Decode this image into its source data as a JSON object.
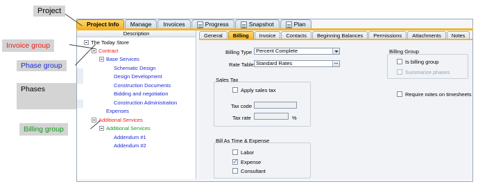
{
  "top_tabs": [
    {
      "label": "Project Info",
      "icon": "",
      "active": true
    },
    {
      "label": "Manage",
      "icon": ""
    },
    {
      "label": "Invoices",
      "icon": ""
    },
    {
      "label": "Progress",
      "icon": "document-icon"
    },
    {
      "label": "Snapshot",
      "icon": "document-icon"
    },
    {
      "label": "Plan",
      "icon": "document-icon"
    }
  ],
  "tree": {
    "header": "Description",
    "rows": [
      {
        "label": "The Today Store",
        "toggle": true,
        "color": "black"
      },
      {
        "label": "Contract",
        "toggle": true,
        "color": "red"
      },
      {
        "label": "Base Services",
        "toggle": true,
        "color": "blue"
      },
      {
        "label": "Schematic Design",
        "toggle": false,
        "color": "blue"
      },
      {
        "label": "Design Development",
        "toggle": false,
        "color": "blue"
      },
      {
        "label": "Construction Documents",
        "toggle": false,
        "color": "blue"
      },
      {
        "label": "Bidding and negotiation",
        "toggle": false,
        "color": "blue"
      },
      {
        "label": "Construction Administration",
        "toggle": false,
        "color": "blue"
      },
      {
        "label": "Expenses",
        "toggle": false,
        "color": "blue"
      },
      {
        "label": "Additional Services",
        "toggle": true,
        "color": "red"
      },
      {
        "label": "Additional Services",
        "toggle": true,
        "color": "green"
      },
      {
        "label": "Addendum #1",
        "toggle": false,
        "color": "blue"
      },
      {
        "label": "Addendum #2",
        "toggle": false,
        "color": "blue"
      }
    ]
  },
  "sub_tabs": [
    {
      "label": "General"
    },
    {
      "label": "Billing",
      "active": true
    },
    {
      "label": "Invoice"
    },
    {
      "label": "Contacts"
    },
    {
      "label": "Beginning Balances"
    },
    {
      "label": "Permissions"
    },
    {
      "label": "Attachments"
    },
    {
      "label": "Notes"
    }
  ],
  "billing": {
    "billing_type_label": "Billing Type",
    "billing_type_value": "Percent Complete",
    "rate_table_label": "Rate Table",
    "rate_table_value": "Standard Rates",
    "sales_tax": {
      "title": "Sales Tax",
      "apply_label": "Apply sales tax",
      "apply_checked": false,
      "tax_code_label": "Tax code",
      "tax_code_value": "",
      "tax_rate_label": "Tax rate",
      "tax_rate_value": "",
      "percent_sign": "%"
    },
    "time_expense": {
      "title": "Bill As Time & Expense",
      "items": [
        {
          "label": "Labor",
          "checked": false
        },
        {
          "label": "Expense",
          "checked": true
        },
        {
          "label": "Consultant",
          "checked": false
        }
      ]
    },
    "billing_group": {
      "title": "Billing Group",
      "is_billing_group_label": "Is billing group",
      "is_billing_group_checked": false,
      "summarize_label": "Summarize phases",
      "summarize_checked": false
    },
    "require_notes_label": "Require notes on timesheets",
    "require_notes_checked": false
  },
  "callouts": {
    "project": "Project",
    "invoice_group": "Invoice group",
    "phase_group": "Phase group",
    "phases": "Phases",
    "billing_group": "Billing group"
  },
  "colors": {
    "accent": "#f5b323",
    "invoice_group_text": "#e8201a",
    "phase_group_text": "#1a2ad6",
    "billing_group_text": "#129a1c"
  }
}
